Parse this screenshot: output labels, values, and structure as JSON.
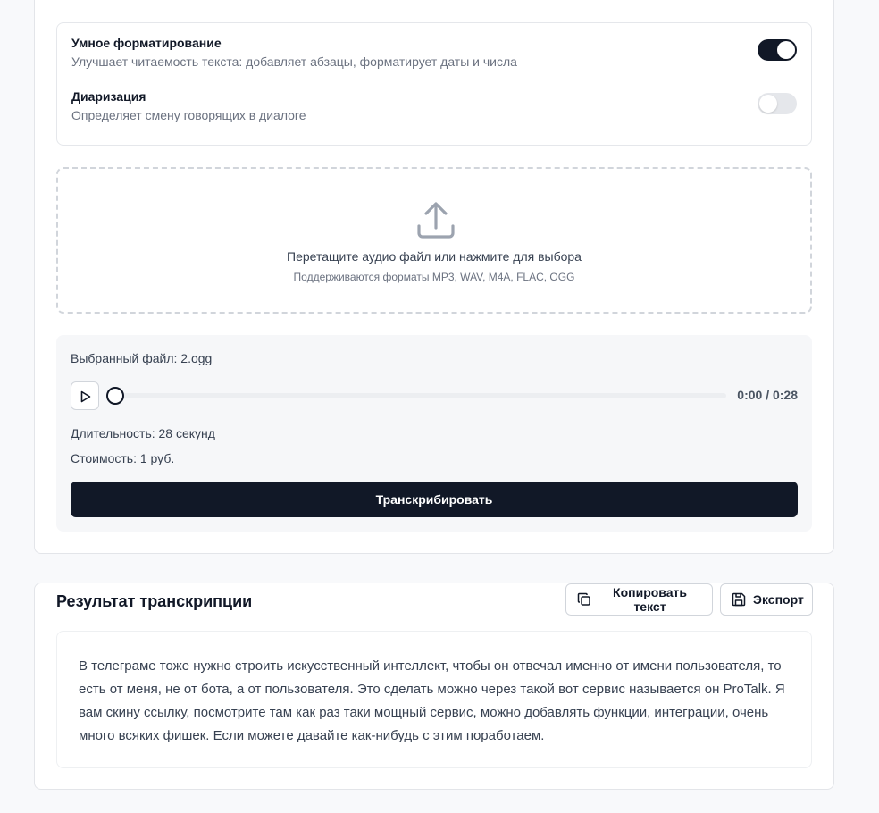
{
  "options": {
    "smart_formatting": {
      "title": "Умное форматирование",
      "description": "Улучшает читаемость текста: добавляет абзацы, форматирует даты и числа",
      "enabled": true
    },
    "diarization": {
      "title": "Диаризация",
      "description": "Определяет смену говорящих в диалоге",
      "enabled": false
    }
  },
  "dropzone": {
    "icon": "upload-icon",
    "title": "Перетащите аудио файл или нажмите для выбора",
    "subtitle": "Поддерживаются форматы MP3, WAV, M4A, FLAC, OGG"
  },
  "file": {
    "selected_label": "Выбранный файл: 2.ogg",
    "time": "0:00 / 0:28",
    "progress_fraction": 0,
    "duration_label": "Длительность: 28 секунд",
    "cost_label": "Стоимость: 1 руб.",
    "transcribe_label": "Транскрибировать"
  },
  "result": {
    "title": "Результат транскрипции",
    "copy_label": "Копировать текст",
    "export_label": "Экспорт",
    "text": "В телеграме тоже нужно строить искусственный интеллект, чтобы он отвечал именно от имени пользователя, то есть от меня, не от бота, а от пользователя. Это сделать можно через такой вот сервис называется он ProTalk. Я вам скину ссылку, посмотрите там как раз таки мощный сервис, можно добавлять функции, интеграции, очень много всяких фишек. Если можете давайте как-нибудь с этим поработаем."
  },
  "colors": {
    "primary": "#111827",
    "toggle_off": "#e5e7eb",
    "muted_text": "#6b7280"
  }
}
